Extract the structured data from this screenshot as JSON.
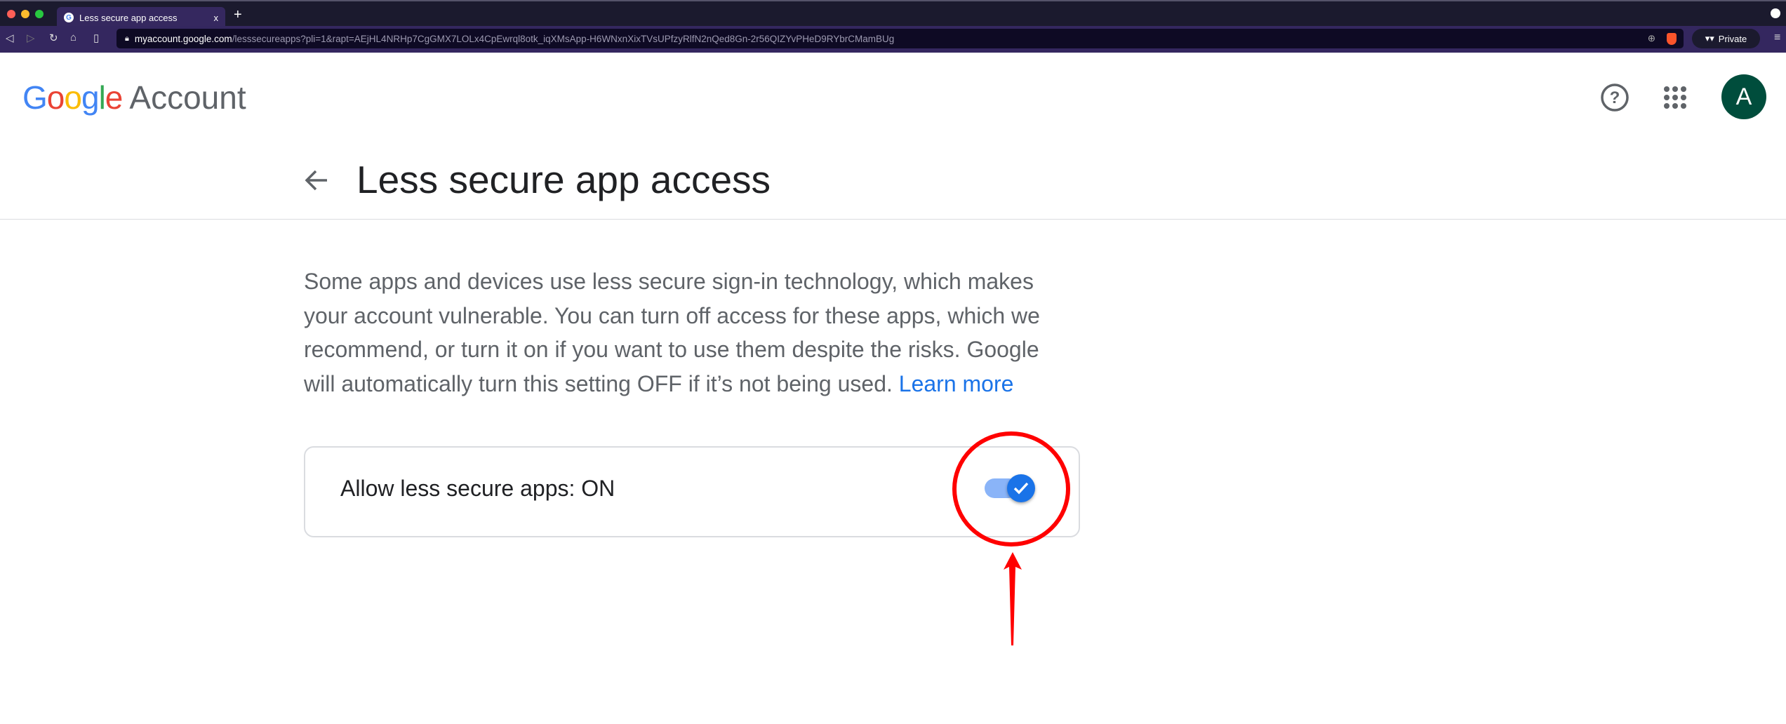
{
  "browser": {
    "tab_title": "Less secure app access",
    "tab_close": "x",
    "new_tab": "+",
    "url_host": "myaccount.google.com",
    "url_path": "/lesssecureapps?pli=1&rapt=AEjHL4NRHp7CgGMX7LOLx4CpEwrql8otk_iqXMsApp-H6WNxnXixTVsUPfzyRlfN2nQed8Gn-2r56QIZYvPHeD9RYbrCMamBUg",
    "private_label": "Private"
  },
  "header": {
    "logo_word": "Google",
    "product": "Account",
    "avatar_initial": "A",
    "avatar_color": "#004d3c"
  },
  "page": {
    "title": "Less secure app access",
    "description": "Some apps and devices use less secure sign-in technology, which makes your account vulnerable. You can turn off access for these apps, which we recommend, or turn it on if you want to use them despite the risks. Google will automatically turn this setting OFF if it’s not being used.",
    "learn_more": "Learn more",
    "setting_label": "Allow less secure apps: ON",
    "setting_on": true
  },
  "colors": {
    "accent": "#1a73e8",
    "annotation": "#ff0000"
  },
  "icons": [
    "back-arrow-icon",
    "help-icon",
    "apps-grid-icon",
    "check-icon",
    "lock-icon",
    "brave-shield-icon",
    "zoom-icon"
  ]
}
